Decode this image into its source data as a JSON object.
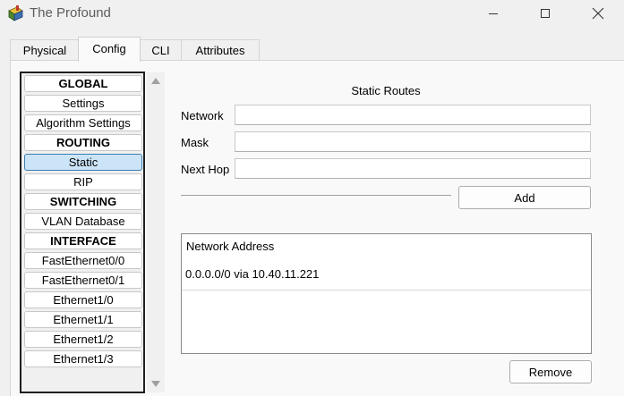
{
  "window": {
    "title": "The Profound",
    "icons": [
      "app-router-icon",
      "minimize-icon",
      "maximize-icon",
      "close-icon"
    ]
  },
  "tabs": [
    {
      "label": "Physical",
      "active": false
    },
    {
      "label": "Config",
      "active": true
    },
    {
      "label": "CLI",
      "active": false
    },
    {
      "label": "Attributes",
      "active": false
    }
  ],
  "sidebar": {
    "items": [
      {
        "label": "GLOBAL",
        "header": true
      },
      {
        "label": "Settings"
      },
      {
        "label": "Algorithm Settings"
      },
      {
        "label": "ROUTING",
        "header": true
      },
      {
        "label": "Static",
        "selected": true
      },
      {
        "label": "RIP"
      },
      {
        "label": "SWITCHING",
        "header": true
      },
      {
        "label": "VLAN Database"
      },
      {
        "label": "INTERFACE",
        "header": true
      },
      {
        "label": "FastEthernet0/0"
      },
      {
        "label": "FastEthernet0/1"
      },
      {
        "label": "Ethernet1/0"
      },
      {
        "label": "Ethernet1/1"
      },
      {
        "label": "Ethernet1/2"
      },
      {
        "label": "Ethernet1/3"
      }
    ]
  },
  "static_routes": {
    "title": "Static Routes",
    "network": {
      "label": "Network",
      "value": ""
    },
    "mask": {
      "label": "Mask",
      "value": ""
    },
    "next_hop": {
      "label": "Next Hop",
      "value": ""
    },
    "add_label": "Add",
    "list_header": "Network Address",
    "routes": [
      "0.0.0.0/0 via 10.40.11.221"
    ],
    "remove_label": "Remove"
  },
  "colors": {
    "selected_bg": "#cce4f7",
    "selected_border": "#3c7fb1",
    "window_bg": "#f0f0f0"
  }
}
